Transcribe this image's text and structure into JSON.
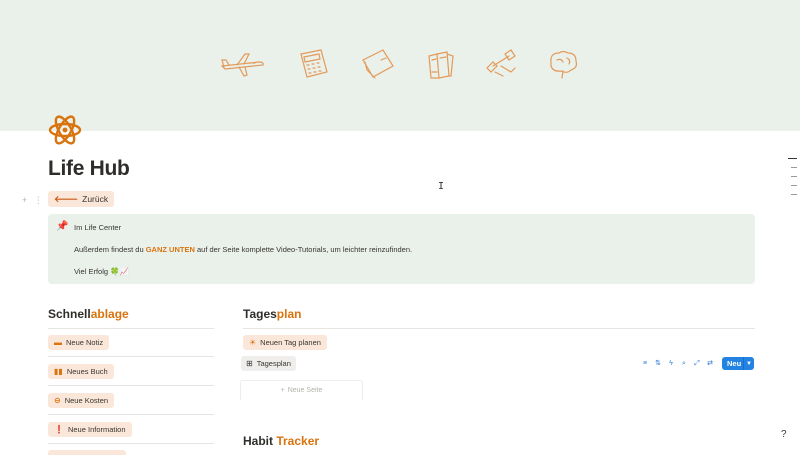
{
  "cover": {
    "icons": [
      "airplane-icon",
      "calculator-icon",
      "wallet-icon",
      "books-icon",
      "dumbbell-icon",
      "brain-icon"
    ],
    "icon_color": "#e49a5a"
  },
  "page": {
    "icon": "atom-icon",
    "title": "Life Hub"
  },
  "back_button": {
    "label": "Zurück"
  },
  "callout": {
    "icon": "pushpin-icon",
    "line1": "Im Life Center",
    "line2_before": "Außerdem findest du ",
    "line2_emph": "GANZ UNTEN",
    "line2_after": " auf der Seite komplette Video-Tutorials, um leichter reinzufinden.",
    "line3": "Viel Erfolg 🍀📈"
  },
  "schnellablage": {
    "heading_plain": "Schnell",
    "heading_accent": "ablage",
    "buttons": [
      {
        "label": "Neue Notiz",
        "icon": "note-icon"
      },
      {
        "label": "Neues Buch",
        "icon": "book-icon"
      },
      {
        "label": "Neue Kosten",
        "icon": "minus-circle-icon"
      },
      {
        "label": "Neue Information",
        "icon": "info-icon"
      }
    ]
  },
  "tagesplan": {
    "heading_plain": "Tages",
    "heading_accent": "plan",
    "plan_button": "Neuen Tag planen",
    "view_tab": "Tagesplan",
    "new_button": "Neu",
    "new_page": "Neue Seite",
    "toolbar_icons": [
      "filter-icon",
      "sort-icon",
      "automation-icon",
      "search-icon",
      "expand-icon",
      "settings-icon"
    ]
  },
  "habit_tracker": {
    "heading_plain": "Habit ",
    "heading_accent": "Tracker"
  },
  "colors": {
    "accent": "#d9730d",
    "cover_bg": "#e9f1ea",
    "chip_bg": "#fbe7d9",
    "primary_blue": "#2383e2"
  }
}
